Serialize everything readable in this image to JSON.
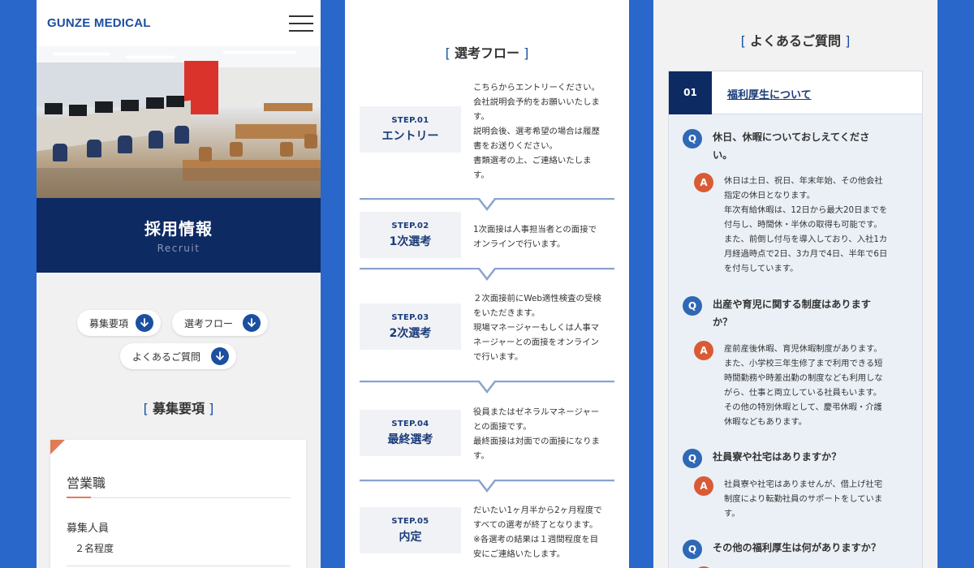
{
  "panel1": {
    "logo": "GUNZE MEDICAL",
    "hero": {
      "title": "採用情報",
      "subtitle": "Recruit"
    },
    "nav_pills": [
      "募集要項",
      "選考フロー",
      "よくあるご質問"
    ],
    "section_title": "募集要項",
    "job_card": {
      "title": "営業職",
      "label": "募集人員",
      "value": "２名程度"
    }
  },
  "panel2": {
    "title": "選考フロー",
    "steps": [
      {
        "number": "STEP.01",
        "label": "エントリー",
        "desc": [
          "こちらからエントリーください。",
          "会社説明会予約をお願いいたしま",
          "す。",
          "説明会後、選考希望の場合は履歴",
          "書をお送りください。",
          "書類選考の上、ご連絡いたしま",
          "す。"
        ]
      },
      {
        "number": "STEP.02",
        "label": "1次選考",
        "desc": [
          "1次面接は人事担当者との面接で",
          "オンラインで行います。"
        ]
      },
      {
        "number": "STEP.03",
        "label": "2次選考",
        "desc": [
          "２次面接前にWeb適性検査の受検",
          "をいただきます。",
          "現場マネージャーもしくは人事マ",
          "ネージャーとの面接をオンライン",
          "で行います。"
        ]
      },
      {
        "number": "STEP.04",
        "label": "最終選考",
        "desc": [
          "役員またはゼネラルマネージャー",
          "との面接です。",
          "最終面接は対面での面接になりま",
          "す。"
        ]
      },
      {
        "number": "STEP.05",
        "label": "内定",
        "desc": [
          "だいたい1ヶ月半から2ヶ月程度で",
          "すべての選考が終了となります。",
          "※各選考の結果は１週間程度を目",
          "安にご連絡いたします。"
        ]
      }
    ]
  },
  "panel3": {
    "title": "よくあるご質問",
    "category": {
      "number": "01",
      "label": "福利厚生について"
    },
    "q_mark": "Q",
    "a_mark": "A",
    "qa": [
      {
        "q": [
          "休日、休暇についておしえてくださ",
          "い。"
        ],
        "a": [
          "休日は土日、祝日、年末年始、その他会社",
          "指定の休日となります。",
          "年次有給休暇は、12日から最大20日までを",
          "付与し、時間休・半休の取得も可能です。",
          "また、前倒し付与を導入しており、入社1カ",
          "月経過時点で2日、3カ月で4日、半年で6日",
          "を付与しています。"
        ]
      },
      {
        "q": [
          "出産や育児に関する制度はあります",
          "か？"
        ],
        "a": [
          "産前産後休暇、育児休暇制度があります。",
          "また、小学校三年生修了まで利用できる短",
          "時間勤務や時差出勤の制度なども利用しな",
          "がら、仕事と両立している社員もいます。",
          "その他の特別休暇として、慶弔休暇・介護",
          "休暇などもあります。"
        ]
      },
      {
        "q": [
          "社員寮や社宅はありますか？"
        ],
        "a": [
          "社員寮や社宅はありませんが、借上げ社宅",
          "制度により転勤社員のサポートをしていま",
          "す。"
        ]
      },
      {
        "q": [
          "その他の福利厚生は何がありますか？"
        ],
        "a": []
      }
    ]
  },
  "colors": {
    "background": "#2a67cb",
    "navy": "#0e2a62",
    "accent_blue": "#1b4fa0",
    "accent_orange": "#d95b35"
  }
}
